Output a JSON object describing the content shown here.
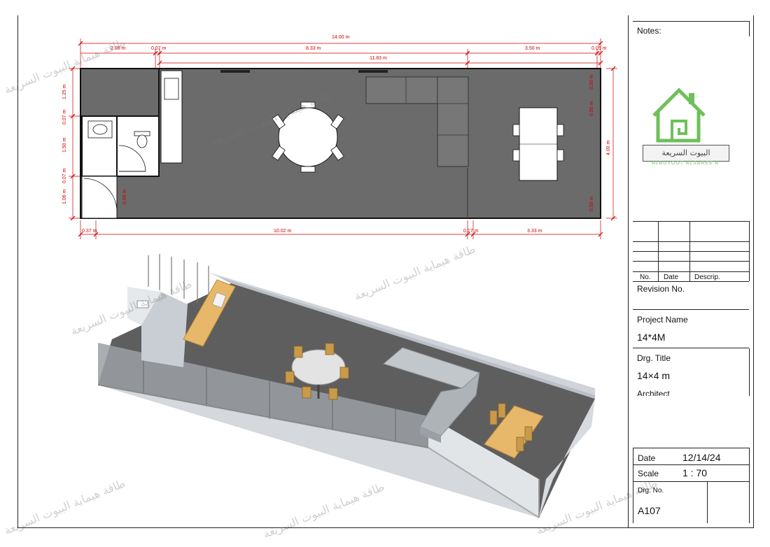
{
  "plan_dims": {
    "overall_length": "14.00 m",
    "top_segments": [
      "2.05 m",
      "0.07 m",
      "8.33 m",
      "3.50 m",
      "0.05 m"
    ],
    "inner_length": "11.83 m",
    "bottom_segments": [
      "0.37 m",
      "10.02 m",
      "0.17 m",
      "3.33 m"
    ],
    "left_vertical": [
      "1.25 m",
      "0.07 m",
      "1.50 m",
      "0.07 m",
      "1.06 m"
    ],
    "door_width": "0.95 m",
    "overall_width": "4.00 m",
    "right_small": [
      "0.50 m",
      "0.50 m",
      "0.50 m"
    ]
  },
  "title_block": {
    "notes_label": "Notes:",
    "logo_arabic": "البيوت السريعة",
    "logo_latin": "ALBUYOOT ALSAREE'A",
    "rev_headers": [
      "No.",
      "Date",
      "Descrip."
    ],
    "revision_label": "Revision No.",
    "project_name_label": "Project Name",
    "project_name": "14*4M",
    "drg_title_label": "Drg. Title",
    "drg_title": "14×4 m",
    "architect_label": "Architect",
    "date_label": "Date",
    "date_value": "12/14/24",
    "scale_label": "Scale",
    "scale_value": "1 : 70",
    "drg_no_label": "Drg. No.",
    "drg_no_value": "A107"
  },
  "watermark": "طاقة هيماية البيوت السريعة",
  "colors": {
    "floor": "#6b6b6b",
    "logo_green": "#6fbf5a",
    "dim_red": "#cc0000",
    "wood": "#e8b86a"
  }
}
